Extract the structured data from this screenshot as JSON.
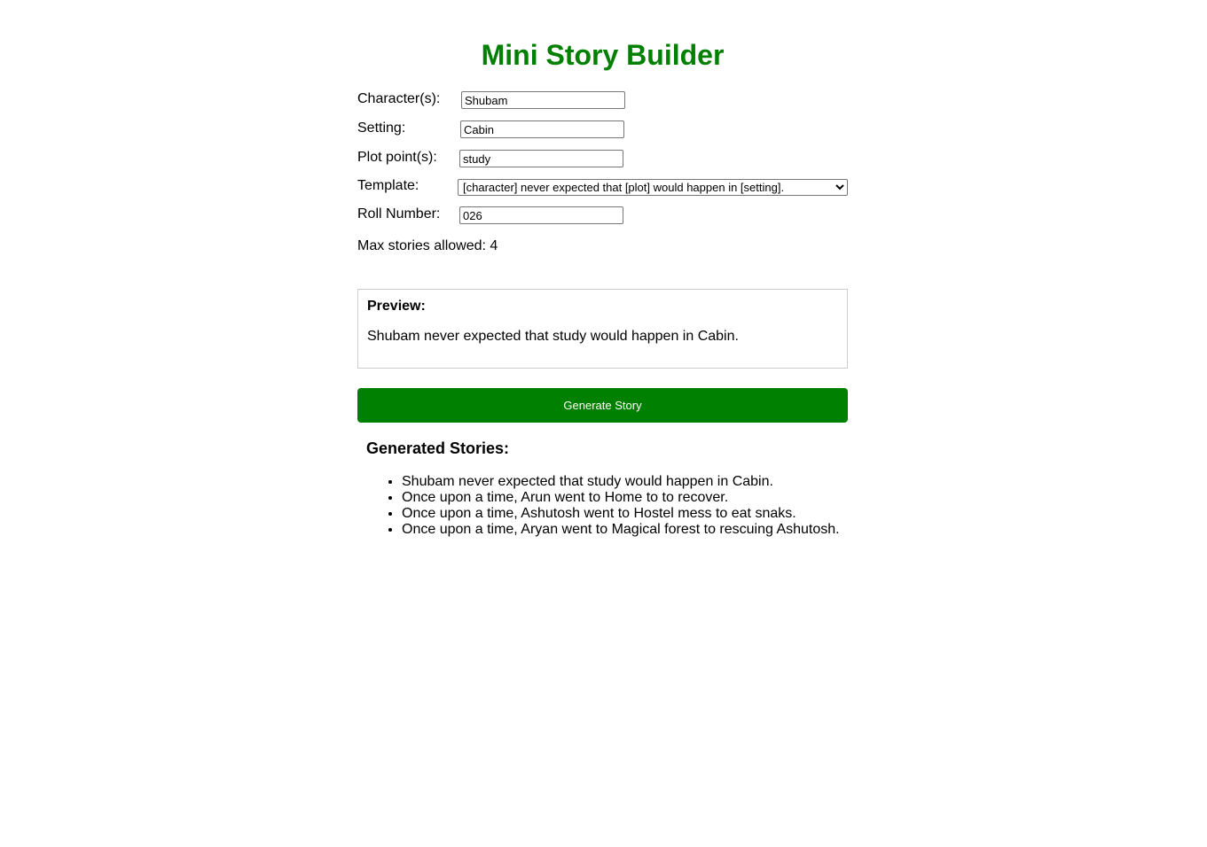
{
  "page": {
    "title": "Mini Story Builder"
  },
  "form": {
    "character": {
      "label": "Character(s):",
      "value": "Shubam"
    },
    "setting": {
      "label": "Setting:",
      "value": "Cabin"
    },
    "plot": {
      "label": "Plot point(s):",
      "value": "study"
    },
    "template": {
      "label": "Template:",
      "selected": "[character] never expected that [plot] would happen in [setting]."
    },
    "roll_number": {
      "label": "Roll Number:",
      "value": "026"
    },
    "max_stories": "Max stories allowed: 4"
  },
  "preview": {
    "heading": "Preview:",
    "text": "Shubam never expected that study would happen in Cabin."
  },
  "generate_button": {
    "label": "Generate Story",
    "color": "#008000"
  },
  "generated": {
    "heading": "Generated Stories:",
    "stories": [
      "Shubam never expected that study would happen in Cabin.",
      "Once upon a time, Arun went to Home to to recover.",
      "Once upon a time, Ashutosh went to Hostel mess to eat snaks.",
      "Once upon a time, Aryan went to Magical forest to rescuing Ashutosh."
    ]
  },
  "colors": {
    "accent": "#008000",
    "preview_border": "#cccccc"
  }
}
